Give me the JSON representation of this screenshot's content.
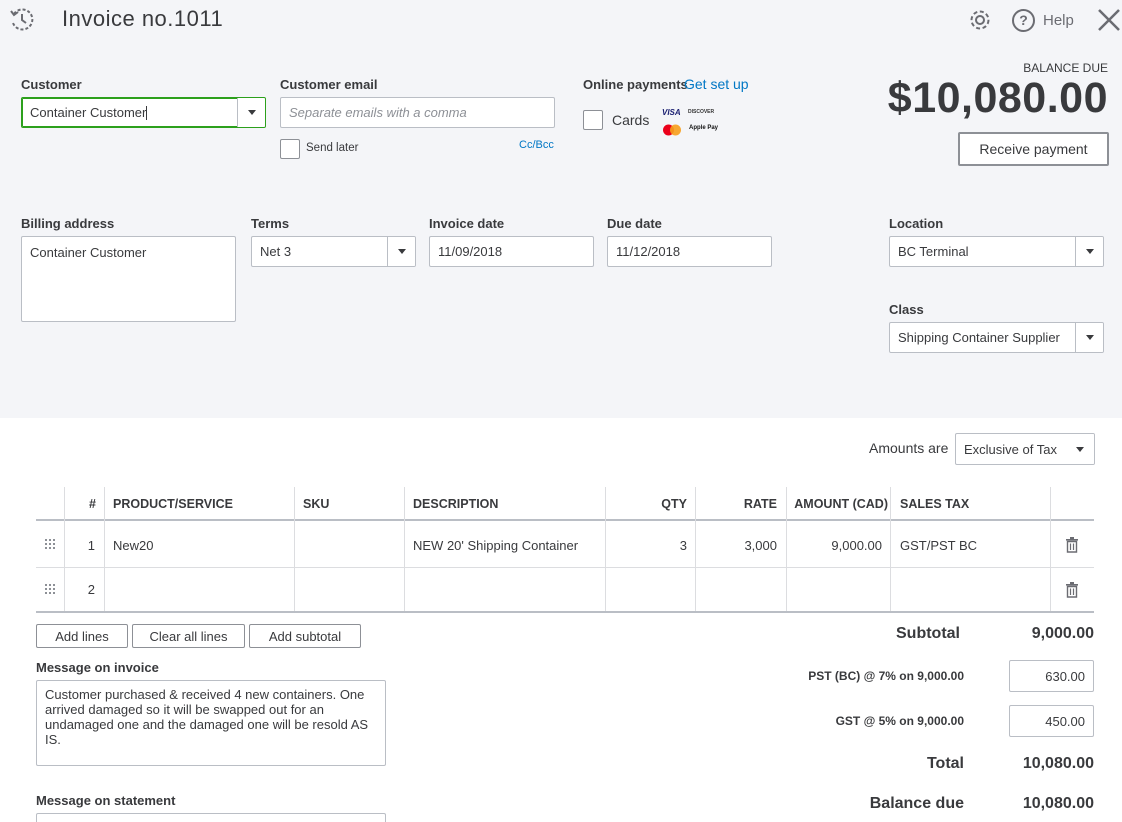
{
  "header": {
    "title": "Invoice no.1011",
    "help_label": "Help"
  },
  "customer": {
    "label": "Customer",
    "value": "Container Customer"
  },
  "customer_email": {
    "label": "Customer email",
    "placeholder": "Separate emails with a comma",
    "send_later_label": "Send later",
    "cc_bcc_label": "Cc/Bcc"
  },
  "online_payments": {
    "label": "Online payments",
    "setup_link": "Get set up",
    "cards_label": "Cards",
    "logos": [
      "VISA",
      "DISCOVER",
      "mastercard",
      "Apple Pay"
    ]
  },
  "balance": {
    "label": "BALANCE DUE",
    "amount": "$10,080.00",
    "receive_payment_label": "Receive payment"
  },
  "billing": {
    "label": "Billing address",
    "value": "Container Customer"
  },
  "terms": {
    "label": "Terms",
    "value": "Net 3"
  },
  "invoice_date": {
    "label": "Invoice date",
    "value": "11/09/2018"
  },
  "due_date": {
    "label": "Due date",
    "value": "11/12/2018"
  },
  "location": {
    "label": "Location",
    "value": "BC Terminal"
  },
  "class_field": {
    "label": "Class",
    "value": "Shipping Container Supplier"
  },
  "amounts_are": {
    "label": "Amounts are",
    "value": "Exclusive of Tax"
  },
  "table": {
    "headers": {
      "num": "#",
      "product": "PRODUCT/SERVICE",
      "sku": "SKU",
      "description": "DESCRIPTION",
      "qty": "QTY",
      "rate": "RATE",
      "amount": "AMOUNT (CAD)",
      "tax": "SALES TAX"
    },
    "rows": [
      {
        "num": "1",
        "product": "New20",
        "sku": "",
        "description": "NEW 20' Shipping Container",
        "qty": "3",
        "rate": "3,000",
        "amount": "9,000.00",
        "tax": "GST/PST BC"
      },
      {
        "num": "2",
        "product": "",
        "sku": "",
        "description": "",
        "qty": "",
        "rate": "",
        "amount": "",
        "tax": ""
      }
    ]
  },
  "line_buttons": {
    "add_lines": "Add lines",
    "clear_all_lines": "Clear all lines",
    "add_subtotal": "Add subtotal"
  },
  "message_invoice": {
    "label": "Message on invoice",
    "value": "Customer purchased & received 4 new containers. One arrived damaged so it will be swapped out for an undamaged one and the damaged one will be resold AS IS."
  },
  "message_statement": {
    "label": "Message on statement"
  },
  "totals": {
    "subtotal_label": "Subtotal",
    "subtotal_value": "9,000.00",
    "pst_label": "PST (BC) @ 7% on 9,000.00",
    "pst_value": "630.00",
    "gst_label": "GST @ 5% on 9,000.00",
    "gst_value": "450.00",
    "total_label": "Total",
    "total_value": "10,080.00",
    "balance_due_label": "Balance due",
    "balance_due_value": "10,080.00"
  },
  "colors": {
    "link": "#0077c5",
    "focus_green": "#2ca01c",
    "top_bg": "#f4f5f8"
  }
}
